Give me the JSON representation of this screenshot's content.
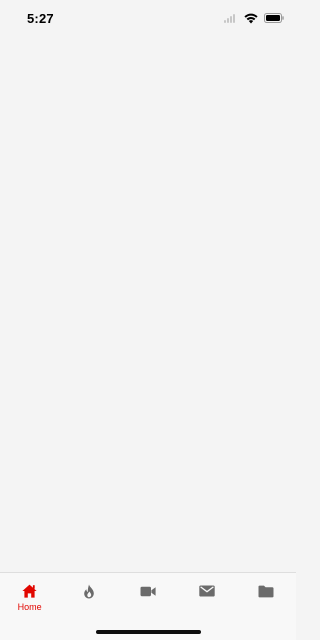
{
  "status_bar": {
    "time": "5:27"
  },
  "tab_bar": {
    "active_color": "#e10600",
    "inactive_color": "#6b6b6b",
    "tabs": [
      {
        "label": "Home",
        "icon": "home-icon",
        "active": true
      },
      {
        "label": "",
        "icon": "fire-icon",
        "active": false
      },
      {
        "label": "",
        "icon": "video-camera-icon",
        "active": false
      },
      {
        "label": "",
        "icon": "envelope-icon",
        "active": false
      },
      {
        "label": "",
        "icon": "folder-icon",
        "active": false
      }
    ]
  }
}
